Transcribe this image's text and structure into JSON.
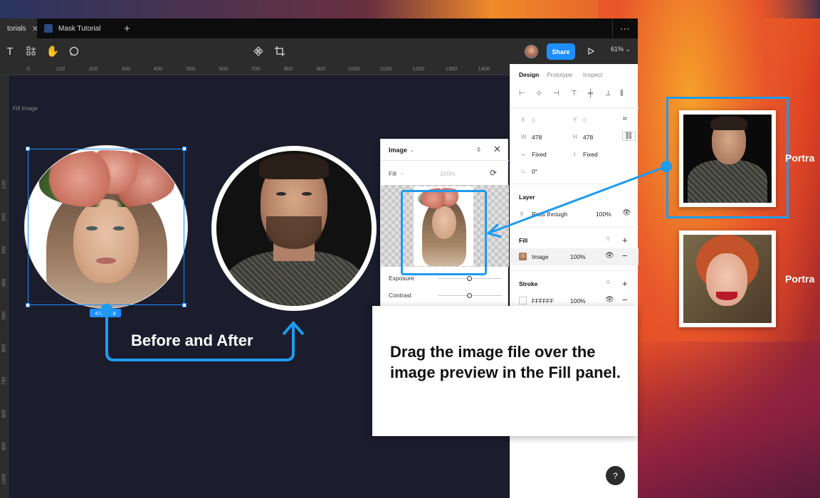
{
  "tabs": [
    {
      "label": "torials",
      "active": true
    },
    {
      "label": "Mask Tutorial",
      "active": false
    }
  ],
  "toolbar": {
    "share_label": "Share",
    "zoom_label": "61%",
    "zoom_caret": "⌄"
  },
  "ruler": {
    "top_ticks": [
      "0",
      "100",
      "200",
      "300",
      "400",
      "500",
      "600",
      "700",
      "800",
      "900",
      "1000",
      "1100",
      "1200",
      "1300",
      "1400"
    ],
    "left_ticks": [
      "100",
      "200",
      "300",
      "400",
      "500",
      "600",
      "700",
      "800",
      "900",
      "1000"
    ]
  },
  "canvas": {
    "frame_label": "Fill Image",
    "size_badge": "478×478",
    "before_after_label": "Before and After"
  },
  "image_panel": {
    "title": "Image",
    "fill_label": "Fill",
    "percent": "100%",
    "exposure_label": "Exposure",
    "contrast_label": "Contrast"
  },
  "design_panel": {
    "tabs": [
      "Design",
      "Prototype",
      "Inspect"
    ],
    "x_label": "X",
    "x_value": "0",
    "y_label": "Y",
    "y_value": "0",
    "w_label": "W",
    "w_value": "478",
    "h_label": "H",
    "h_value": "478",
    "fixed_w": "Fixed",
    "fixed_h": "Fixed",
    "rotation": "0°",
    "layer_title": "Layer",
    "blend_mode": "Pass through",
    "layer_opacity": "100%",
    "fill_title": "Fill",
    "fill_type": "Image",
    "fill_opacity": "100%",
    "stroke_title": "Stroke",
    "stroke_color": "FFFFFF",
    "stroke_opacity": "100%"
  },
  "callout": {
    "text": "Drag the image file over the image preview in the Fill panel."
  },
  "portraits": [
    {
      "label": "Portra"
    },
    {
      "label": "Portra"
    }
  ],
  "colors": {
    "accent": "#1e8fff",
    "annotation": "#1e9bf0",
    "canvas_bg": "#1b1c2c"
  }
}
